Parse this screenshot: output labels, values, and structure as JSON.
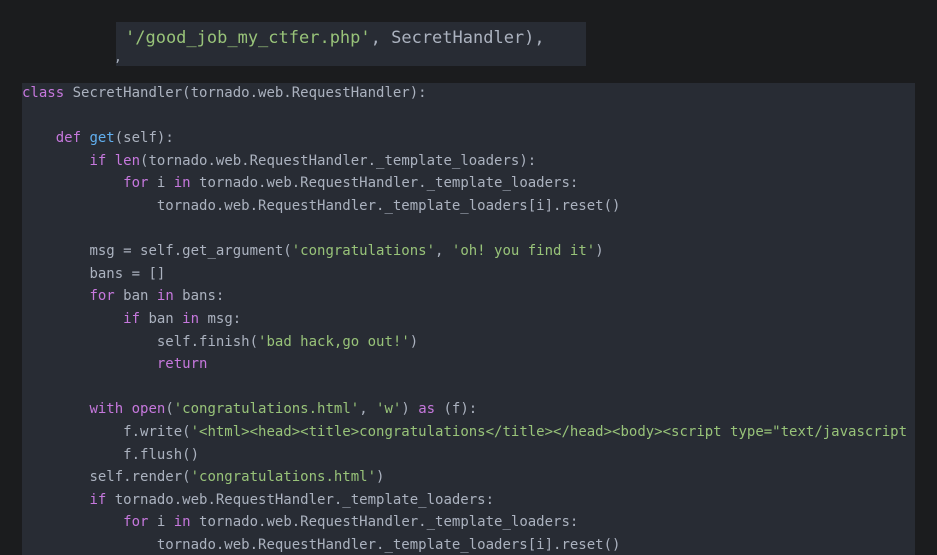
{
  "colors": {
    "background": "#1b1c1e",
    "code_background": "#282c34",
    "plain": "#abb2bf",
    "keyword": "#c678dd",
    "function": "#61afef",
    "string": "#98c379"
  },
  "top_snippet": {
    "string": "'/good_job_my_ctfer.php'",
    "rest": ", SecretHandler),",
    "stray": ","
  },
  "code_lines": [
    {
      "indent": 0,
      "tokens": [
        {
          "t": "kw",
          "v": "class"
        },
        {
          "t": "pl",
          "v": " SecretHandler(tornado.web.RequestHandler):"
        }
      ]
    },
    {
      "indent": 0,
      "tokens": []
    },
    {
      "indent": 4,
      "tokens": [
        {
          "t": "kw",
          "v": "def"
        },
        {
          "t": "pl",
          "v": " "
        },
        {
          "t": "fn",
          "v": "get"
        },
        {
          "t": "pl",
          "v": "(self):"
        }
      ]
    },
    {
      "indent": 8,
      "tokens": [
        {
          "t": "kw",
          "v": "if"
        },
        {
          "t": "pl",
          "v": " "
        },
        {
          "t": "kw",
          "v": "len"
        },
        {
          "t": "pl",
          "v": "(tornado.web.RequestHandler._template_loaders):"
        }
      ]
    },
    {
      "indent": 12,
      "tokens": [
        {
          "t": "kw",
          "v": "for"
        },
        {
          "t": "pl",
          "v": " i "
        },
        {
          "t": "kw",
          "v": "in"
        },
        {
          "t": "pl",
          "v": " tornado.web.RequestHandler._template_loaders:"
        }
      ]
    },
    {
      "indent": 16,
      "tokens": [
        {
          "t": "pl",
          "v": "tornado.web.RequestHandler._template_loaders[i].reset()"
        }
      ]
    },
    {
      "indent": 0,
      "tokens": []
    },
    {
      "indent": 8,
      "tokens": [
        {
          "t": "pl",
          "v": "msg = self.get_argument("
        },
        {
          "t": "str",
          "v": "'congratulations'"
        },
        {
          "t": "pl",
          "v": ", "
        },
        {
          "t": "str",
          "v": "'oh! you find it'"
        },
        {
          "t": "pl",
          "v": ")"
        }
      ]
    },
    {
      "indent": 8,
      "tokens": [
        {
          "t": "pl",
          "v": "bans = []"
        }
      ]
    },
    {
      "indent": 8,
      "tokens": [
        {
          "t": "kw",
          "v": "for"
        },
        {
          "t": "pl",
          "v": " ban "
        },
        {
          "t": "kw",
          "v": "in"
        },
        {
          "t": "pl",
          "v": " bans:"
        }
      ]
    },
    {
      "indent": 12,
      "tokens": [
        {
          "t": "kw",
          "v": "if"
        },
        {
          "t": "pl",
          "v": " ban "
        },
        {
          "t": "kw",
          "v": "in"
        },
        {
          "t": "pl",
          "v": " msg:"
        }
      ]
    },
    {
      "indent": 16,
      "tokens": [
        {
          "t": "pl",
          "v": "self.finish("
        },
        {
          "t": "str",
          "v": "'bad hack,go out!'"
        },
        {
          "t": "pl",
          "v": ")"
        }
      ]
    },
    {
      "indent": 16,
      "tokens": [
        {
          "t": "kw",
          "v": "return"
        }
      ]
    },
    {
      "indent": 0,
      "tokens": []
    },
    {
      "indent": 8,
      "tokens": [
        {
          "t": "kw",
          "v": "with"
        },
        {
          "t": "pl",
          "v": " "
        },
        {
          "t": "kw",
          "v": "open"
        },
        {
          "t": "pl",
          "v": "("
        },
        {
          "t": "str",
          "v": "'congratulations.html'"
        },
        {
          "t": "pl",
          "v": ", "
        },
        {
          "t": "str",
          "v": "'w'"
        },
        {
          "t": "pl",
          "v": ") "
        },
        {
          "t": "kw",
          "v": "as"
        },
        {
          "t": "pl",
          "v": " (f):"
        }
      ]
    },
    {
      "indent": 12,
      "tokens": [
        {
          "t": "pl",
          "v": "f.write("
        },
        {
          "t": "str",
          "v": "'<html><head><title>congratulations</title></head><body><script type=\"text/javascript"
        }
      ]
    },
    {
      "indent": 12,
      "tokens": [
        {
          "t": "pl",
          "v": "f.flush()"
        }
      ]
    },
    {
      "indent": 8,
      "tokens": [
        {
          "t": "pl",
          "v": "self.render("
        },
        {
          "t": "str",
          "v": "'congratulations.html'"
        },
        {
          "t": "pl",
          "v": ")"
        }
      ]
    },
    {
      "indent": 8,
      "tokens": [
        {
          "t": "kw",
          "v": "if"
        },
        {
          "t": "pl",
          "v": " tornado.web.RequestHandler._template_loaders:"
        }
      ]
    },
    {
      "indent": 12,
      "tokens": [
        {
          "t": "kw",
          "v": "for"
        },
        {
          "t": "pl",
          "v": " i "
        },
        {
          "t": "kw",
          "v": "in"
        },
        {
          "t": "pl",
          "v": " tornado.web.RequestHandler._template_loaders:"
        }
      ]
    },
    {
      "indent": 16,
      "tokens": [
        {
          "t": "pl",
          "v": "tornado.web.RequestHandler._template_loaders[i].reset()"
        }
      ]
    }
  ]
}
